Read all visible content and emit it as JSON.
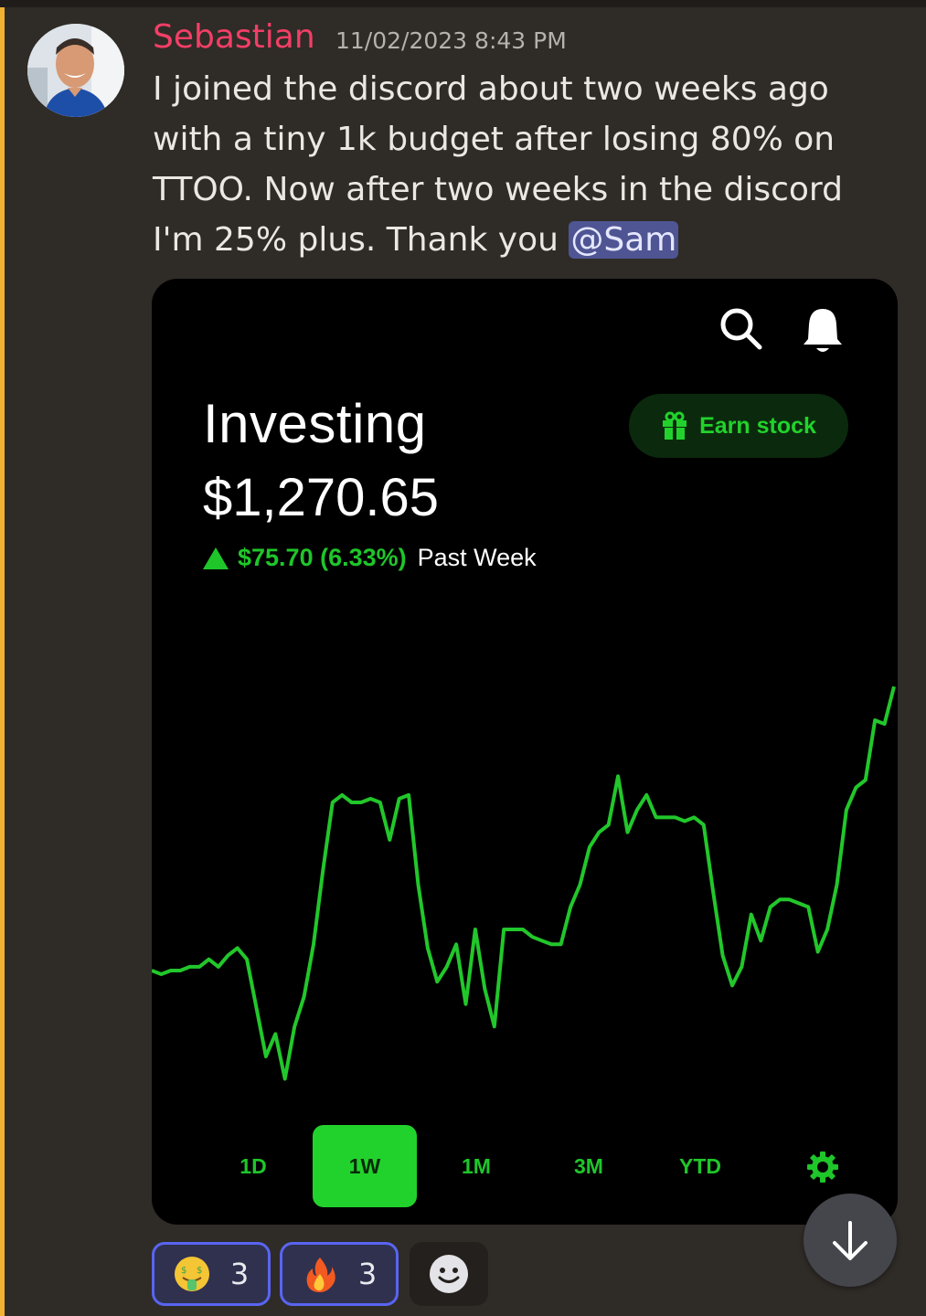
{
  "message": {
    "author": "Sebastian",
    "timestamp": "11/02/2023 8:43 PM",
    "text": "I joined the discord about two weeks ago with a tiny 1k budget after losing 80% on TTOO. Now after two weeks in the discord I'm 25% plus. Thank you ",
    "mention": "@Sam",
    "author_color": "#f23f66"
  },
  "attachment": {
    "title": "Investing",
    "amount": "$1,270.65",
    "change_value": "$75.70 (6.33%)",
    "change_period": "Past Week",
    "earn_button": "Earn stock",
    "icons": [
      "search-icon",
      "bell-icon",
      "gift-icon",
      "gear-icon",
      "up-triangle-icon"
    ],
    "accent_color": "#22d22c",
    "ranges": [
      {
        "label": "1D",
        "active": false
      },
      {
        "label": "1W",
        "active": true
      },
      {
        "label": "1M",
        "active": false
      },
      {
        "label": "3M",
        "active": false
      },
      {
        "label": "YTD",
        "active": false
      }
    ]
  },
  "chart_data": {
    "type": "line",
    "title": "",
    "xlabel": "",
    "ylabel": "",
    "grid": false,
    "series": [
      {
        "values": [
          1195,
          1194,
          1195,
          1195,
          1196,
          1196,
          1198,
          1196,
          1199,
          1201,
          1198,
          1185,
          1172,
          1178,
          1166,
          1180,
          1188,
          1202,
          1222,
          1240,
          1242,
          1240,
          1240,
          1241,
          1240,
          1230,
          1241,
          1242,
          1218,
          1201,
          1192,
          1196,
          1202,
          1186,
          1206,
          1190,
          1180,
          1206,
          1206,
          1206,
          1204,
          1203,
          1202,
          1202,
          1212,
          1218,
          1228,
          1232,
          1234,
          1247,
          1232,
          1238,
          1242,
          1236,
          1236,
          1236,
          1235,
          1236,
          1234,
          1216,
          1199,
          1191,
          1196,
          1210,
          1203,
          1212,
          1214,
          1214,
          1213,
          1212,
          1200,
          1206,
          1218,
          1238,
          1244,
          1246,
          1262,
          1261,
          1271
        ]
      }
    ]
  },
  "reactions": [
    {
      "emoji": "money-mouth-face-icon",
      "count": "3",
      "mine": true
    },
    {
      "emoji": "fire-icon",
      "count": "3",
      "mine": true
    }
  ],
  "add_reaction_icon": "smiley-add-icon",
  "scroll_button_icon": "arrow-down-icon"
}
